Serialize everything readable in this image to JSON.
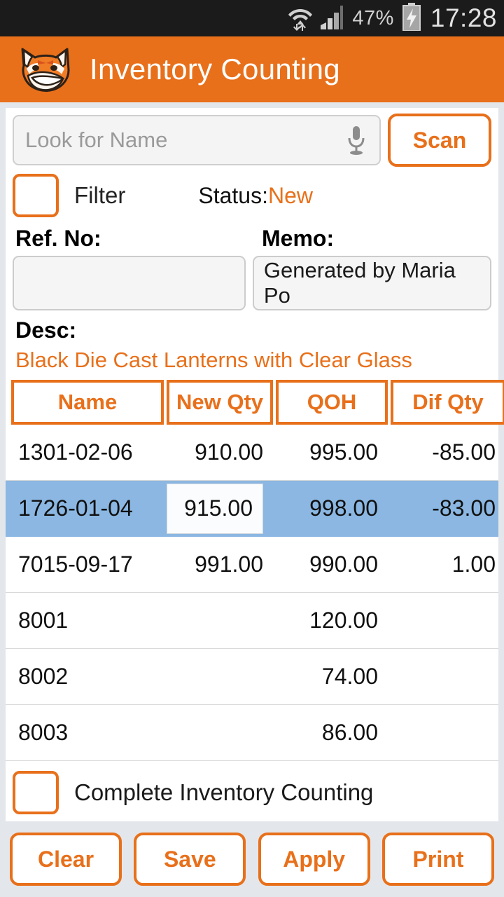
{
  "status_bar": {
    "wifi_icon": "wifi-icon",
    "signal_icon": "cellular-signal-icon",
    "battery_percent": "47%",
    "battery_icon": "battery-charging-icon",
    "clock": "17:28"
  },
  "app_bar": {
    "logo_icon": "fox-logo-icon",
    "title": "Inventory Counting"
  },
  "search": {
    "placeholder": "Look for Name",
    "value": "",
    "mic_icon": "microphone-icon",
    "scan_label": "Scan"
  },
  "filter": {
    "label": "Filter",
    "checked": false,
    "status_label": "Status:",
    "status_value": "New"
  },
  "form": {
    "ref_label": "Ref. No:",
    "ref_value": "",
    "memo_label": "Memo:",
    "memo_value": "Generated by Maria Po",
    "desc_label": "Desc:",
    "desc_value": "Black Die Cast Lanterns with Clear Glass"
  },
  "table": {
    "columns": [
      "Name",
      "New Qty",
      "QOH",
      "Dif Qty"
    ],
    "rows": [
      {
        "name": "1301-02-06",
        "new_qty": "910.00",
        "qoh": "995.00",
        "dif_qty": "-85.00",
        "selected": false,
        "editing": false
      },
      {
        "name": "1726-01-04",
        "new_qty": "915.00",
        "qoh": "998.00",
        "dif_qty": "-83.00",
        "selected": true,
        "editing": true
      },
      {
        "name": "7015-09-17",
        "new_qty": "991.00",
        "qoh": "990.00",
        "dif_qty": "1.00",
        "selected": false,
        "editing": false
      },
      {
        "name": "8001",
        "new_qty": "",
        "qoh": "120.00",
        "dif_qty": "",
        "selected": false,
        "editing": false
      },
      {
        "name": "8002",
        "new_qty": "",
        "qoh": "74.00",
        "dif_qty": "",
        "selected": false,
        "editing": false
      },
      {
        "name": "8003",
        "new_qty": "",
        "qoh": "86.00",
        "dif_qty": "",
        "selected": false,
        "editing": false
      }
    ]
  },
  "complete": {
    "label": "Complete Inventory Counting",
    "checked": false
  },
  "actions": [
    {
      "label": "Clear",
      "name": "clear-button"
    },
    {
      "label": "Save",
      "name": "save-button"
    },
    {
      "label": "Apply",
      "name": "apply-button"
    },
    {
      "label": "Print",
      "name": "print-button"
    }
  ],
  "colors": {
    "accent_orange": "#e8701b",
    "selected_row_blue": "#8bb7e2",
    "page_background": "#e3e7eb",
    "status_bar": "#1b1b1b"
  }
}
